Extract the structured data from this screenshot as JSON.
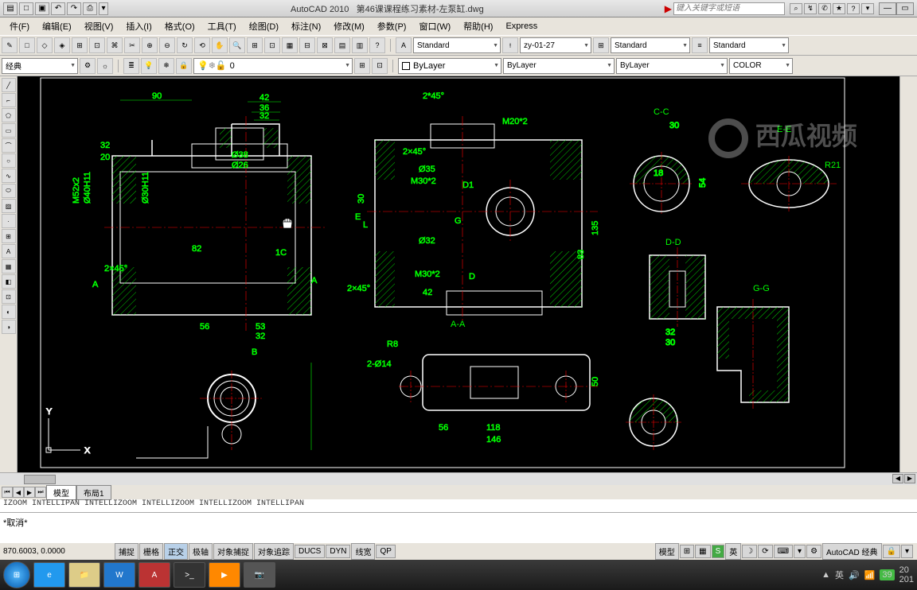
{
  "title": {
    "app": "AutoCAD 2010",
    "file": "第46课课程练习素材-左泵缸.dwg"
  },
  "search_placeholder": "键入关键字或短语",
  "menu": [
    "件(F)",
    "编辑(E)",
    "视图(V)",
    "插入(I)",
    "格式(O)",
    "工具(T)",
    "绘图(D)",
    "标注(N)",
    "修改(M)",
    "参数(P)",
    "窗口(W)",
    "帮助(H)",
    "Express"
  ],
  "toolbar1": {
    "textstyle": "Standard",
    "dimstyle": "zy-01-27",
    "tablestyle": "Standard",
    "mlstyle": "Standard"
  },
  "toolbar2": {
    "workspace": "经典",
    "layer": "0",
    "color": "ByLayer",
    "ltype": "ByLayer",
    "lweight": "ByLayer",
    "plotstyle": "COLOR"
  },
  "tabs": {
    "model": "模型",
    "layout1": "布局1"
  },
  "cmd_history": "IZOOM INTELLIPAN INTELLIZOOM INTELLIZOOM INTELLIZOOM INTELLIPAN",
  "cmd_prompt": "*取消*",
  "status": {
    "coords": "870.6003, 0.0000",
    "snap": "捕捉",
    "grid": "栅格",
    "ortho": "正交",
    "polar": "极轴",
    "osnap": "对象捕捉",
    "otrack": "对象追踪",
    "ducs": "DUCS",
    "dyn": "DYN",
    "lwt": "线宽",
    "qp": "QP",
    "model": "模型",
    "ws": "AutoCAD 经典"
  },
  "drawing": {
    "sections": {
      "aa": "A-A",
      "cc": "C-C",
      "dd": "D-D",
      "ee": "E-E",
      "gg": "G-G"
    },
    "dims": {
      "d90": "90",
      "d42": "42",
      "d36": "36",
      "d32a": "32",
      "d32b": "32",
      "d20": "20",
      "d038": "Ø38",
      "d026": "Ø26",
      "d040h11": "Ø40H11",
      "d030h11": "Ø30H11",
      "dm52x2": "M52x2",
      "d82": "82",
      "d1c": "1C",
      "d2x45a": "2×45°",
      "d56a": "56",
      "d53": "53",
      "d32c": "32",
      "db": "B",
      "da": "A",
      "d2x45b": "2*45°",
      "dm20x2": "M20*2",
      "d035": "Ø35",
      "dm30x2a": "M30*2",
      "dd1": "D1",
      "d30a": "30",
      "d032": "Ø32",
      "dm30x2b": "M30*2",
      "de": "E",
      "dl": "L",
      "dg": "G",
      "dd": "D",
      "d2x45c": "2×45°",
      "d42b": "42",
      "d135": "135",
      "d83": "83",
      "dr8": "R8",
      "d2014": "2-Ø14",
      "d50": "50",
      "d56b": "56",
      "d118": "118",
      "d146": "146",
      "d30b": "30",
      "d18": "18",
      "d54": "54",
      "dr21": "R21",
      "d32d": "32",
      "d30c": "30"
    }
  },
  "tray": {
    "ime": "英",
    "time": "20",
    "notif": "39",
    "year": "201"
  }
}
